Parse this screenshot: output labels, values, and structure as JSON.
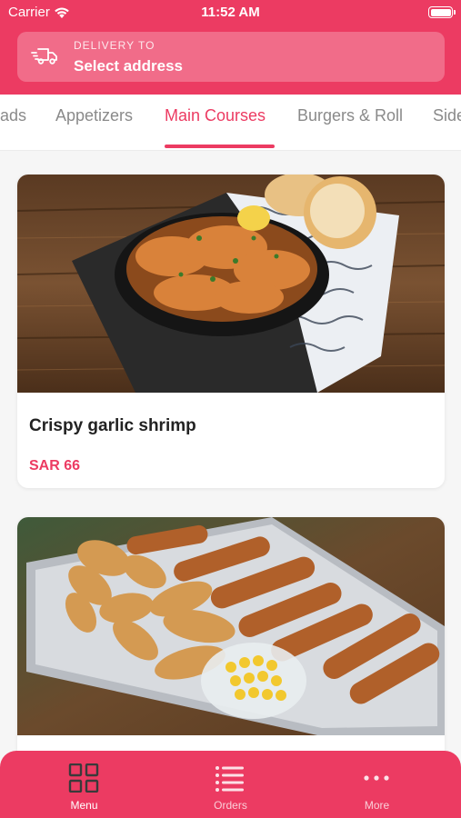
{
  "status": {
    "carrier": "Carrier",
    "time": "11:52 AM"
  },
  "delivery": {
    "caption": "DELIVERY TO",
    "address": "Select address"
  },
  "tabs": [
    {
      "label": "ads"
    },
    {
      "label": "Appetizers"
    },
    {
      "label": "Main Courses"
    },
    {
      "label": "Burgers & Roll"
    },
    {
      "label": "Side"
    }
  ],
  "active_tab": "Main Courses",
  "items": [
    {
      "name": "Crispy garlic shrimp",
      "price": "SAR 66",
      "image_icon": "shrimp-dish-image"
    },
    {
      "name": "",
      "price": "",
      "image_icon": "fried-chicken-fries-image"
    }
  ],
  "bottom_nav": {
    "menu": "Menu",
    "orders": "Orders",
    "more": "More"
  },
  "colors": {
    "accent": "#ec3b62",
    "background": "#f6f6f6"
  }
}
